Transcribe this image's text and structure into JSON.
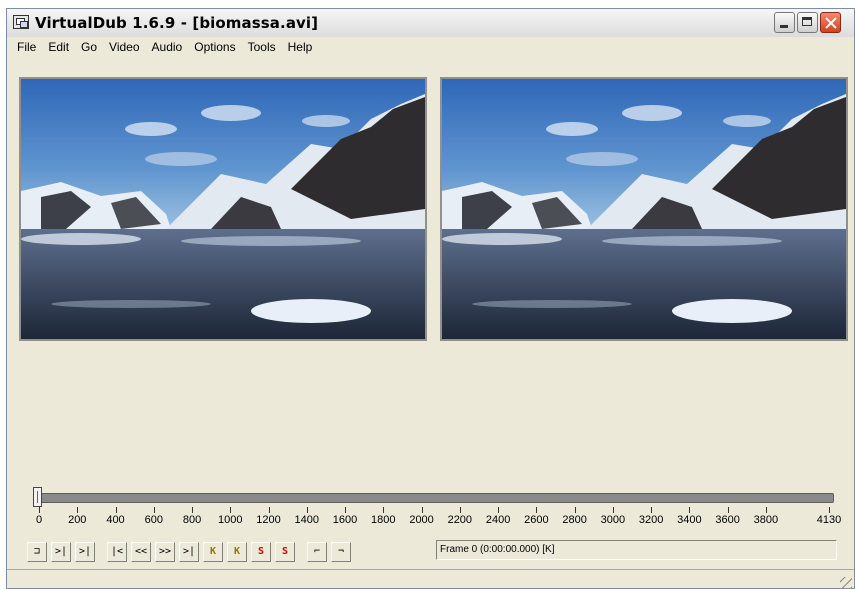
{
  "window": {
    "title": "VirtualDub 1.6.9 - [biomassa.avi]"
  },
  "menu": [
    "File",
    "Edit",
    "Go",
    "Video",
    "Audio",
    "Options",
    "Tools",
    "Help"
  ],
  "timeline": {
    "tick_labels": [
      "0",
      "200",
      "400",
      "600",
      "800",
      "1000",
      "1200",
      "1400",
      "1600",
      "1800",
      "2000",
      "2200",
      "2400",
      "2600",
      "2800",
      "3000",
      "3200",
      "3400",
      "3600",
      "3800",
      "4130"
    ],
    "total_frames": 4130,
    "current_frame": 0
  },
  "toolbar": {
    "buttons": [
      {
        "name": "stop-icon",
        "glyph": "⊐"
      },
      {
        "name": "play-input-icon",
        "glyph": ">|"
      },
      {
        "name": "play-output-icon",
        "glyph": ">|"
      },
      {
        "name": "start-icon",
        "glyph": "|<"
      },
      {
        "name": "prev-frame-icon",
        "glyph": "<<"
      },
      {
        "name": "next-frame-icon",
        "glyph": ">>"
      },
      {
        "name": "end-icon",
        "glyph": ">|"
      },
      {
        "name": "prev-keyframe-icon",
        "glyph": "K"
      },
      {
        "name": "next-keyframe-icon",
        "glyph": "K"
      },
      {
        "name": "prev-scene-icon",
        "glyph": "S"
      },
      {
        "name": "next-scene-icon",
        "glyph": "S"
      },
      {
        "name": "mark-in-icon",
        "glyph": "⌐"
      },
      {
        "name": "mark-out-icon",
        "glyph": "¬"
      }
    ]
  },
  "status": {
    "frame_text": "Frame 0 (0:00:00.000) [K]"
  }
}
